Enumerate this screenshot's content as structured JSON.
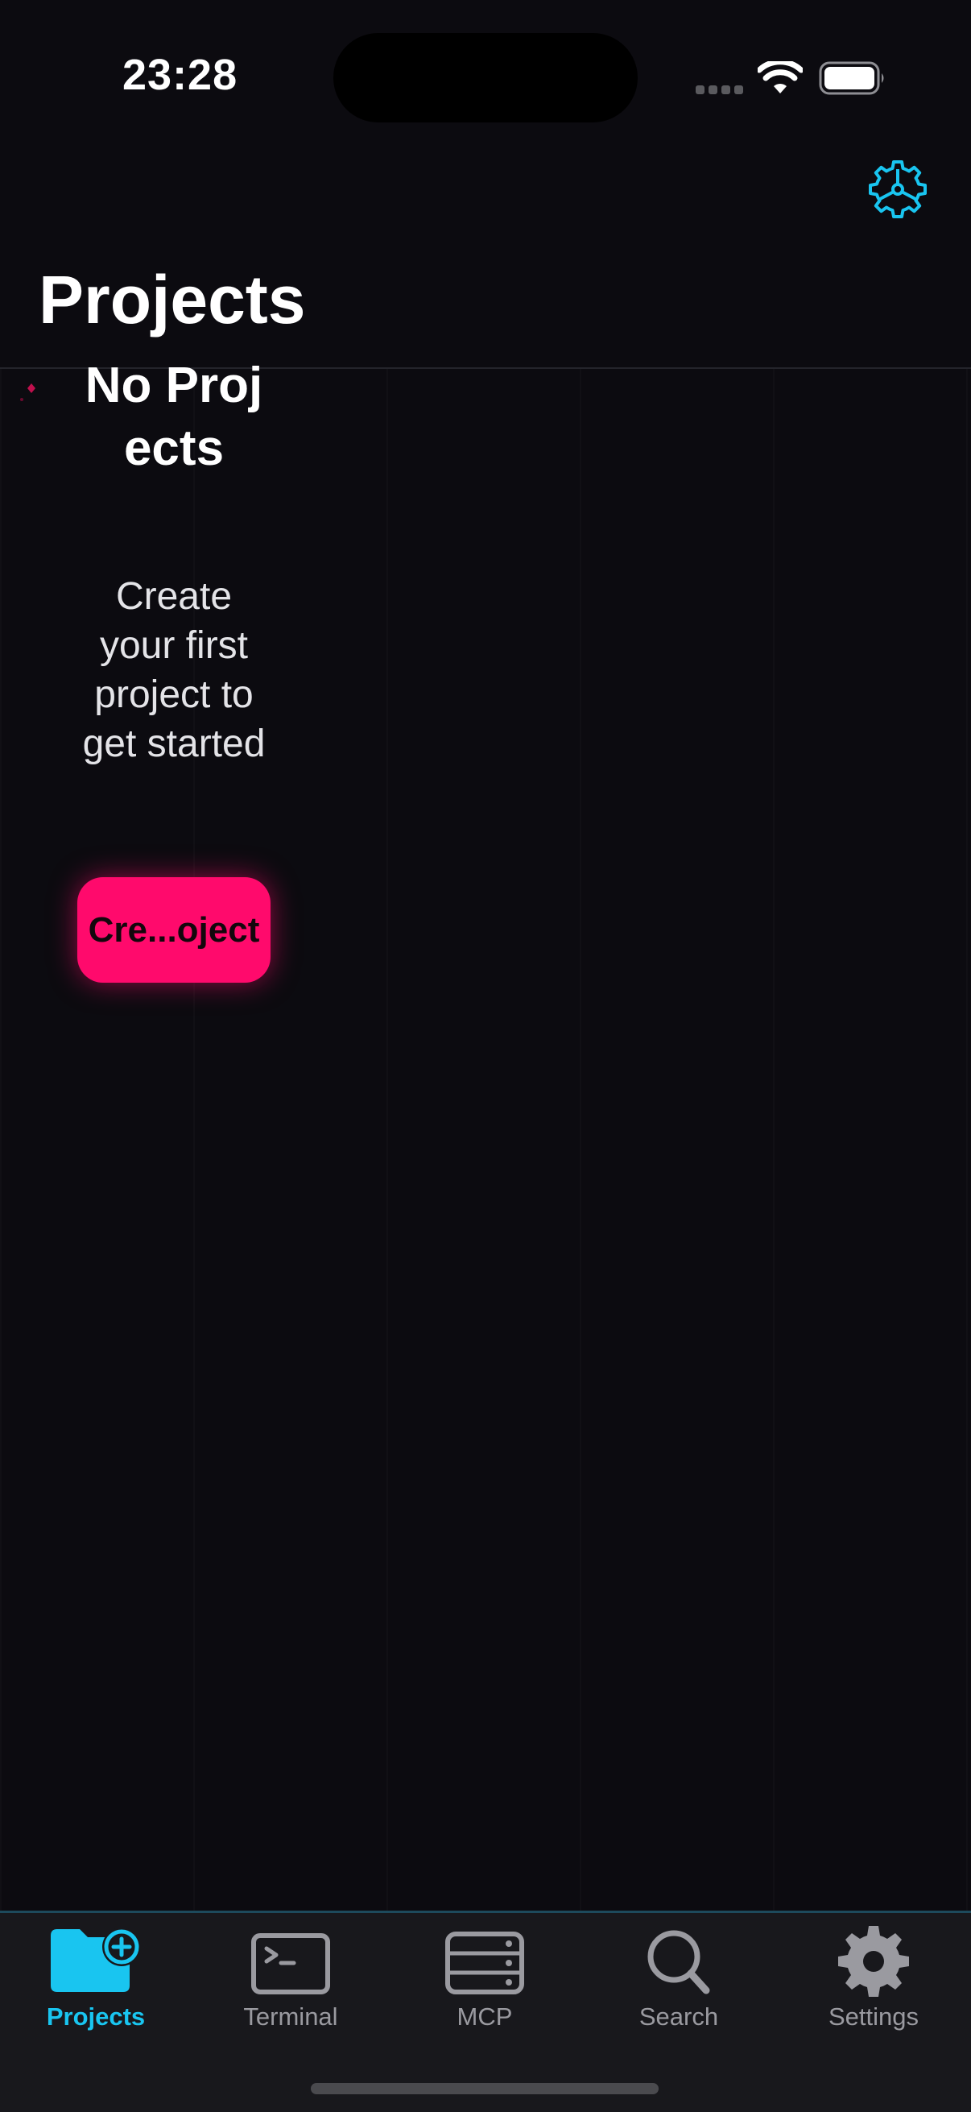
{
  "status_bar": {
    "time": "23:28"
  },
  "header": {
    "title": "Projects",
    "settings_icon": "gear-icon"
  },
  "empty_state": {
    "title": "No Projects",
    "message": "Create your first project to get started",
    "button_label": "Cre...oject"
  },
  "tabs": [
    {
      "label": "Projects",
      "icon": "folder-plus-icon",
      "active": true
    },
    {
      "label": "Terminal",
      "icon": "terminal-icon",
      "active": false
    },
    {
      "label": "MCP",
      "icon": "server-icon",
      "active": false
    },
    {
      "label": "Search",
      "icon": "search-icon",
      "active": false
    },
    {
      "label": "Settings",
      "icon": "gear-icon",
      "active": false
    }
  ],
  "colors": {
    "background": "#0c0b10",
    "accent_cyan": "#19c5f0",
    "accent_pink": "#ff0a6c",
    "tab_inactive": "#9a9aa0",
    "tab_bar_background": "#18181c"
  }
}
